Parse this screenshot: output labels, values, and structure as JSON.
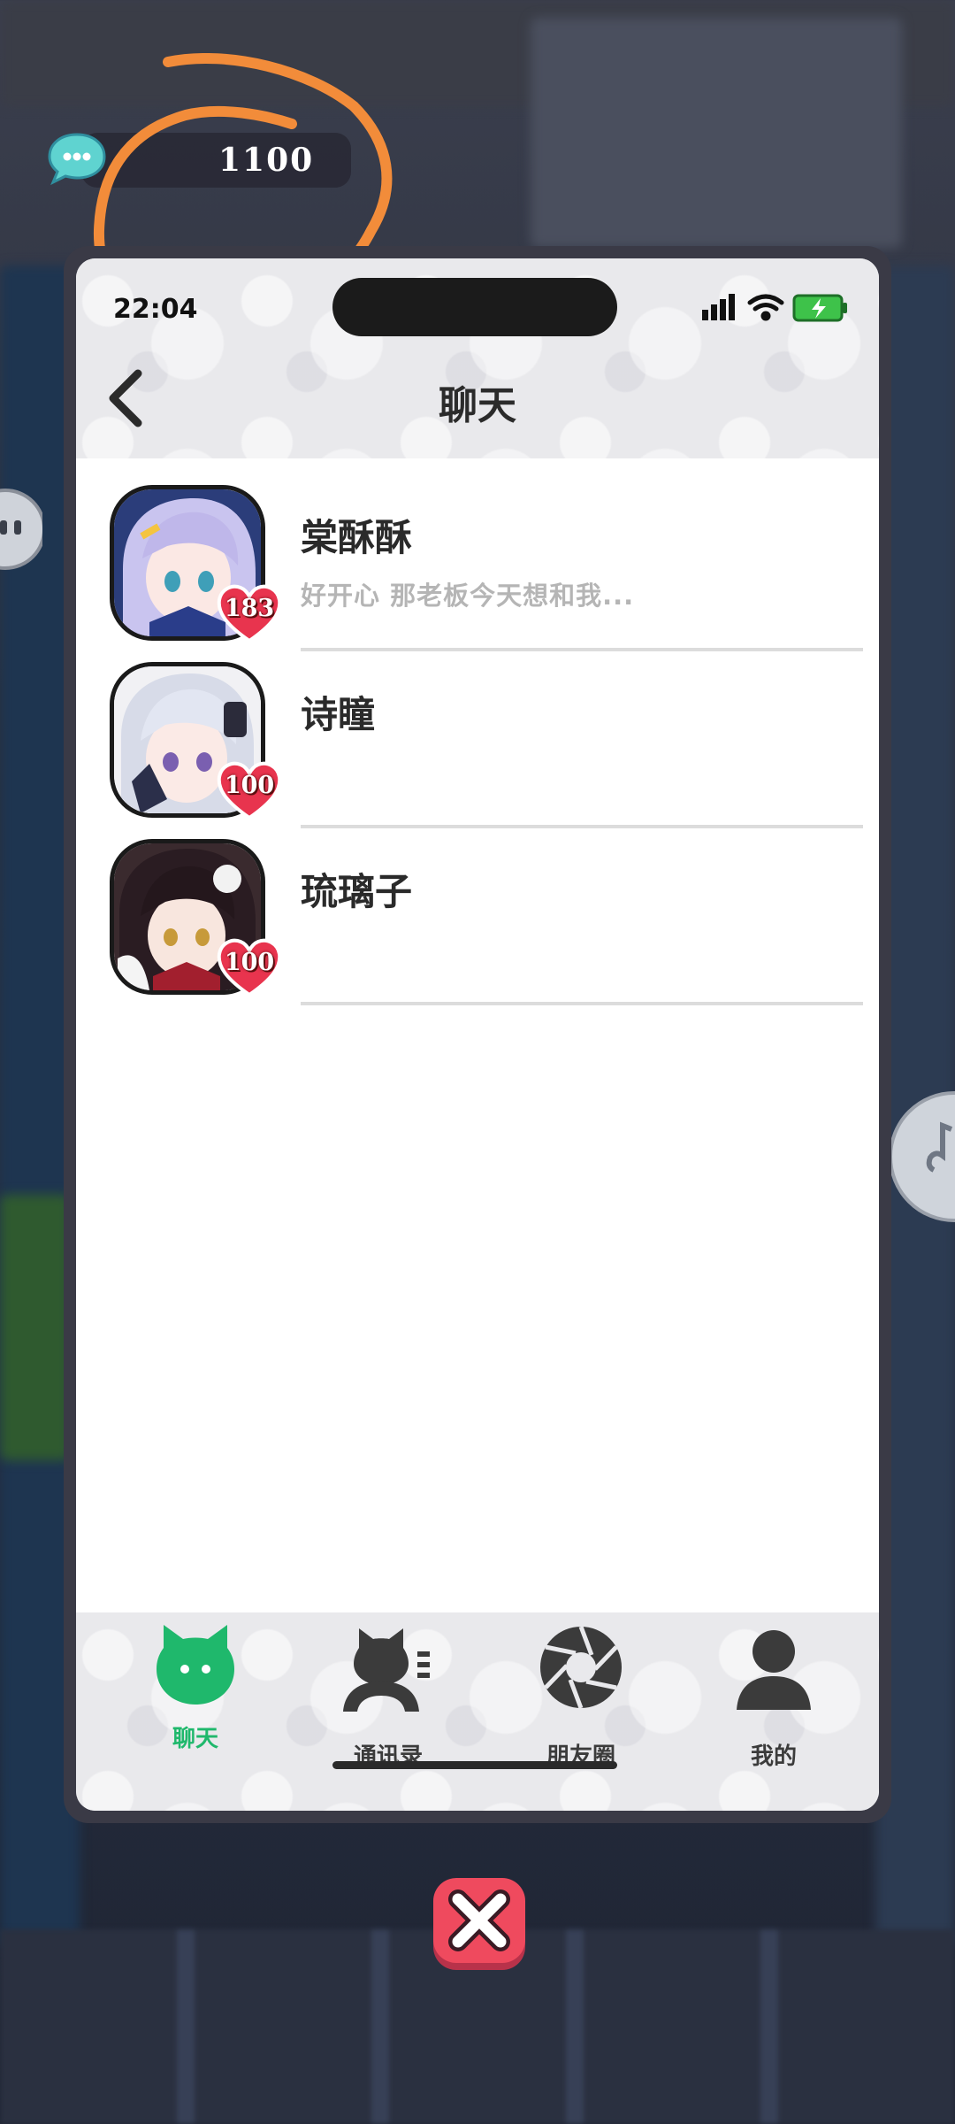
{
  "currency": {
    "value": "1100",
    "icon": "chat-bubble-icon"
  },
  "status_bar": {
    "time": "22:04"
  },
  "header": {
    "title": "聊天"
  },
  "chats": [
    {
      "name": "棠酥酥",
      "preview": "好开心 那老板今天想和我...",
      "affection": "183"
    },
    {
      "name": "诗瞳",
      "preview": "",
      "affection": "100"
    },
    {
      "name": "琉璃子",
      "preview": "",
      "affection": "100"
    }
  ],
  "tabs": [
    {
      "label": "聊天",
      "icon": "cat-chat-icon",
      "active": true
    },
    {
      "label": "通讯录",
      "icon": "contacts-icon",
      "active": false
    },
    {
      "label": "朋友圈",
      "icon": "aperture-icon",
      "active": false
    },
    {
      "label": "我的",
      "icon": "person-icon",
      "active": false
    }
  ],
  "colors": {
    "accent": "#1fb86c",
    "badge": "#e8344e",
    "annotation": "#f28c3a",
    "close": "#ef4a5e"
  }
}
